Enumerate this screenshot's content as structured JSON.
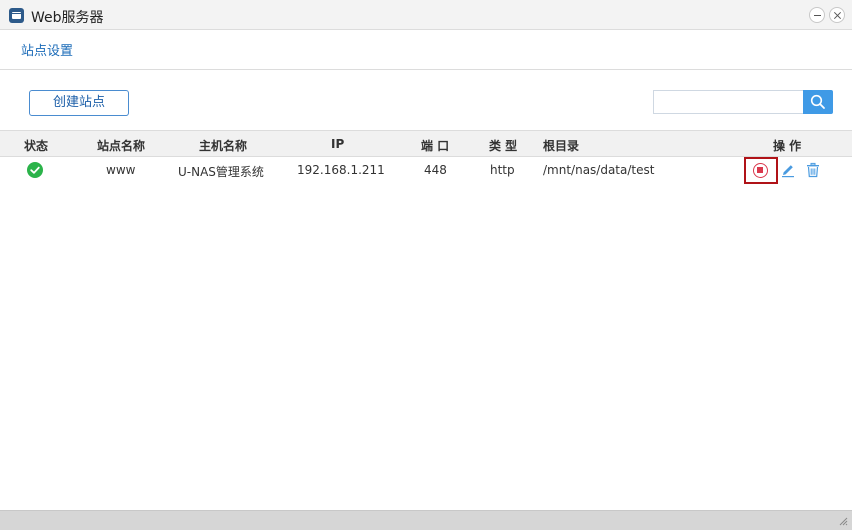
{
  "window": {
    "title": "Web服务器",
    "icon": "window-app-icon"
  },
  "subnav": {
    "site_settings": "站点设置"
  },
  "toolbar": {
    "create_site_label": "创建站点",
    "search_placeholder": ""
  },
  "table": {
    "headers": {
      "status": "状态",
      "site_name": "站点名称",
      "host_name": "主机名称",
      "ip": "IP",
      "port": "端 口",
      "type": "类 型",
      "root_dir": "根目录",
      "actions": "操 作"
    },
    "rows": [
      {
        "status": "running",
        "site_name": "www",
        "host_name": "U-NAS管理系统",
        "ip": "192.168.1.211",
        "port": "448",
        "type": "http",
        "root_dir": "/mnt/nas/data/test",
        "actions": [
          "stop-icon",
          "edit-icon",
          "trash-icon"
        ]
      }
    ]
  },
  "colors": {
    "accent": "#3f9ae6",
    "link": "#1b6bb8",
    "status_ok": "#2bb34a",
    "stop": "#d9374c",
    "highlight": "#b01318"
  }
}
